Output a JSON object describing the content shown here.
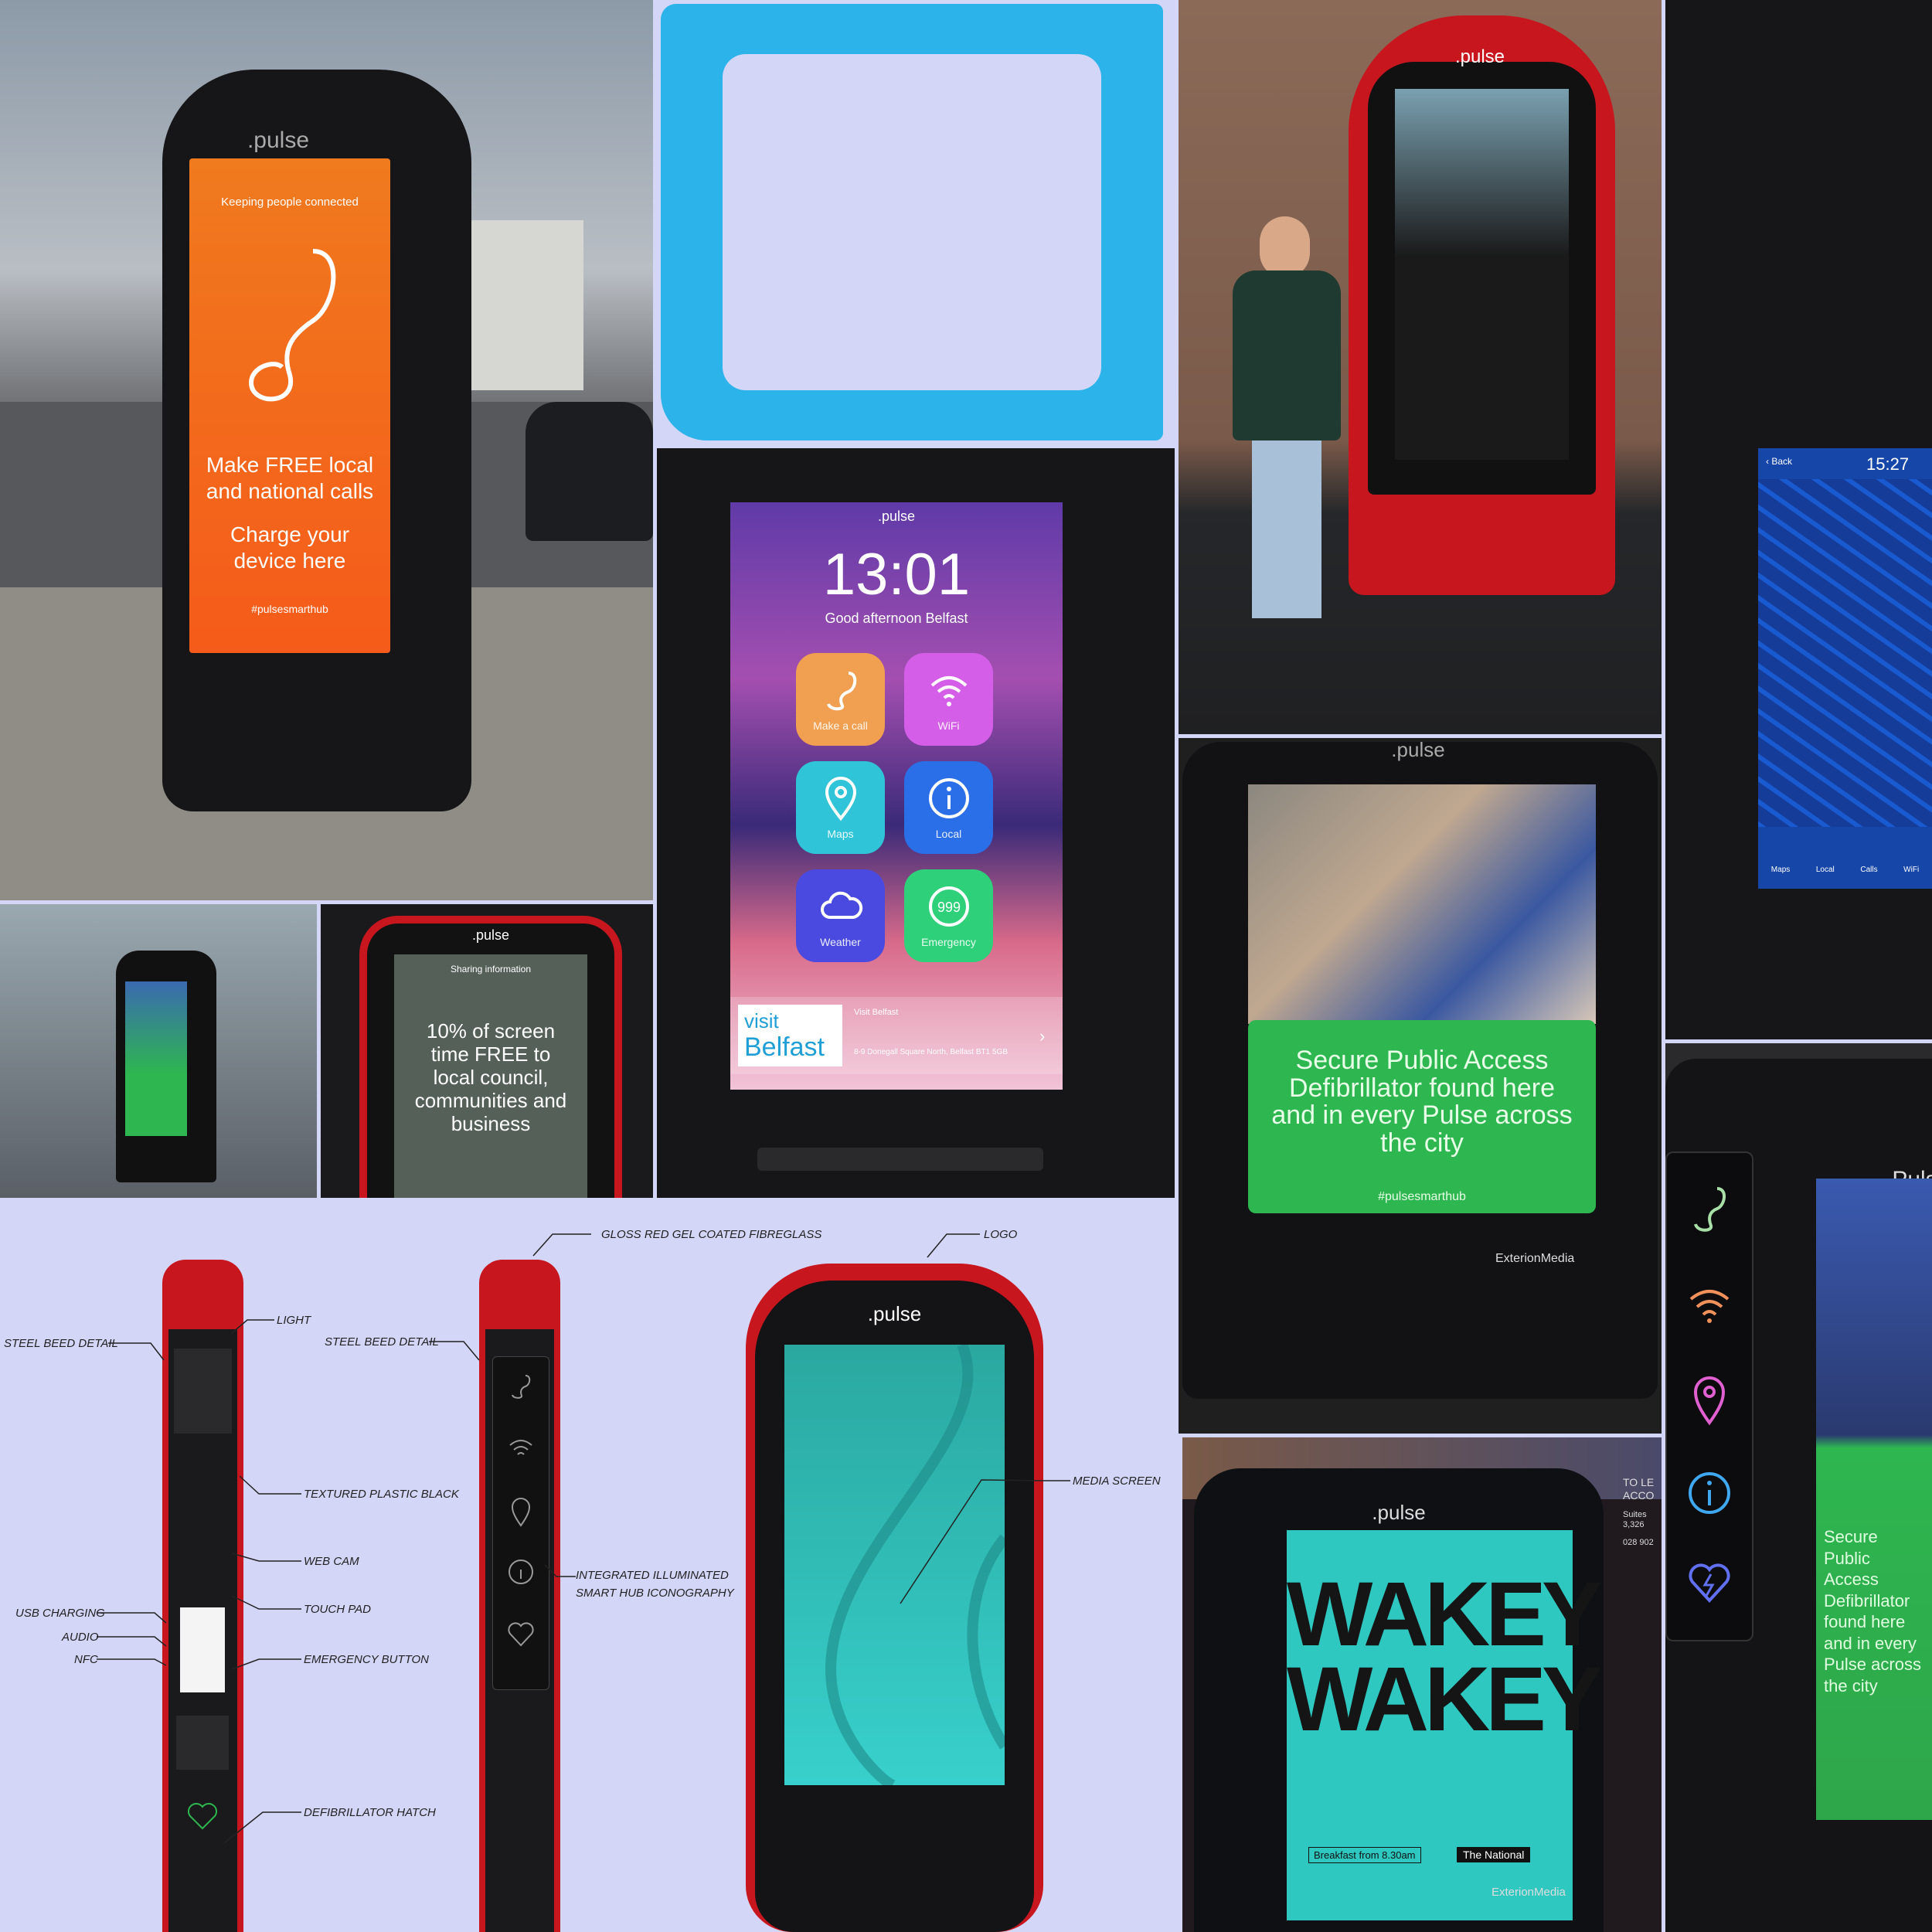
{
  "kiosk_street": {
    "brand": ".pulse",
    "tagline": "Keeping people connected",
    "headline": "Make FREE local and national calls",
    "subline": "Charge your device here",
    "hashtag": "#pulsesmarthub"
  },
  "home_screen": {
    "brand": ".pulse",
    "time": "13:01",
    "greeting": "Good afternoon Belfast",
    "buttons": [
      {
        "label": "Make a call",
        "icon": "phone-icon",
        "color": "#f0a050"
      },
      {
        "label": "WiFi",
        "icon": "wifi-icon",
        "color": "#d45ee8"
      },
      {
        "label": "Maps",
        "icon": "map-pin-icon",
        "color": "#2fc4d8"
      },
      {
        "label": "Local",
        "icon": "info-icon",
        "color": "#2a6ee8"
      },
      {
        "label": "Weather",
        "icon": "cloud-icon",
        "color": "#4a4ae0"
      },
      {
        "label": "Emergency",
        "icon": "emergency-999-icon",
        "color": "#2ed07a"
      }
    ],
    "banner_visit": "visit",
    "banner_city": "Belfast",
    "banner_small": "Visit Belfast",
    "banner_address": "8-9 Donegall Square North, Belfast BT1 5GB"
  },
  "prototype": {
    "brand": ".pulse"
  },
  "map_screen": {
    "back": "Back",
    "time": "15:27",
    "nav": [
      "Maps",
      "Local",
      "Calls",
      "WiFi"
    ]
  },
  "sharing": {
    "brand": ".pulse",
    "header": "Sharing information",
    "body": "10% of screen time FREE to local council, communities and business"
  },
  "defib_ad": {
    "brand": ".pulse",
    "body": "Secure Public Access Defibrillator found here and in every Pulse across the city",
    "hashtag": "#pulsesmarthub",
    "media": "ExterionMedia"
  },
  "side_panel": {
    "brand": ".Pulse",
    "text": "Secure Public Access Defibrillator found here and in every Pulse across the city"
  },
  "wakey": {
    "brand": ".pulse",
    "line1": "WAKEY",
    "line2": "WAKEY",
    "footer_left": "Breakfast from 8.30am",
    "footer_right": "The National",
    "media": "ExterionMedia",
    "bg_sign": "TO LE ACCO",
    "bg_sign_2": "Suites 3,326",
    "bg_sign_3": "028 902"
  },
  "diagram": {
    "brand": ".pulse",
    "labels": {
      "steel_beed_1": "STEEL BEED DETAIL",
      "light": "LIGHT",
      "textured": "TEXTURED PLASTIC BLACK",
      "webcam": "WEB CAM",
      "touchpad": "TOUCH PAD",
      "usb": "USB CHARGING",
      "audio": "AUDIO",
      "nfc": "NFC",
      "emergency": "EMERGENCY BUTTON",
      "defib": "DEFIBRILLATOR HATCH",
      "gloss": "GLOSS RED GEL COATED FIBREGLASS",
      "steel_beed_2": "STEEL BEED DETAIL",
      "integrated": "INTEGRATED ILLUMINATED",
      "smart": "SMART HUB ICONOGRAPHY",
      "logo": "LOGO",
      "media": "MEDIA SCREEN"
    }
  },
  "colors": {
    "background": "#d4d6f7",
    "pulse_red": "#c8161e",
    "orange": "#f07a1e",
    "green_ad": "#2eb650",
    "teal_screen": "#2ec8c0",
    "blue_frame": "#2bb3ea"
  }
}
